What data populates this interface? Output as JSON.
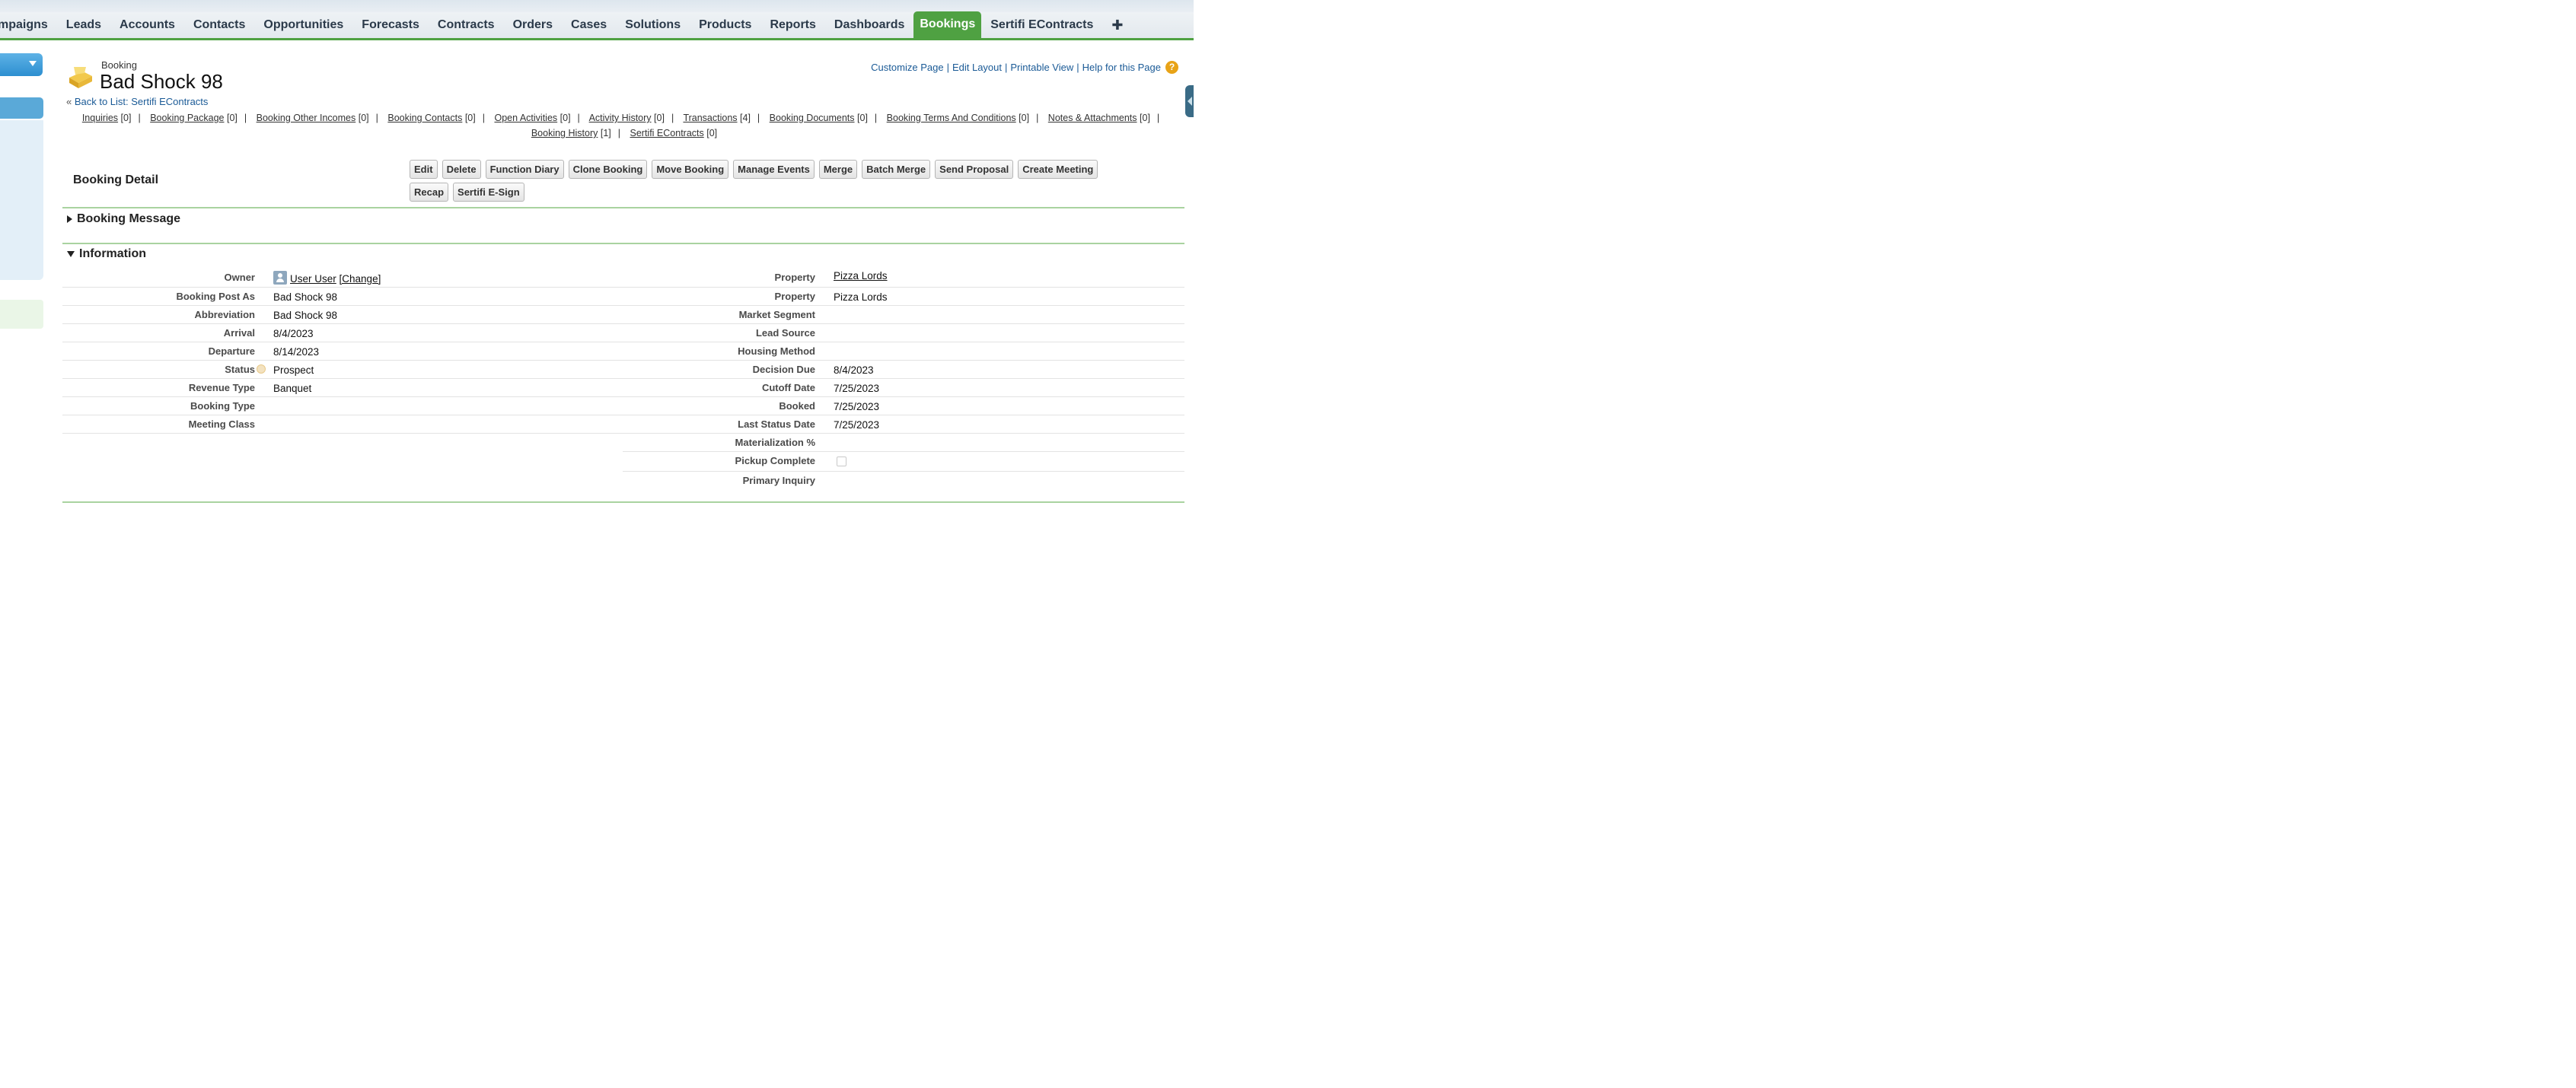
{
  "tabs": [
    {
      "label": "mpaigns"
    },
    {
      "label": "Leads"
    },
    {
      "label": "Accounts"
    },
    {
      "label": "Contacts"
    },
    {
      "label": "Opportunities"
    },
    {
      "label": "Forecasts"
    },
    {
      "label": "Contracts"
    },
    {
      "label": "Orders"
    },
    {
      "label": "Cases"
    },
    {
      "label": "Solutions"
    },
    {
      "label": "Products"
    },
    {
      "label": "Reports"
    },
    {
      "label": "Dashboards"
    },
    {
      "label": "Bookings"
    },
    {
      "label": "Sertifi EContracts"
    },
    {
      "label": "✚"
    }
  ],
  "colors": {
    "accent_green": "#4fa142",
    "link_blue": "#1a5a96"
  },
  "header": {
    "record_type": "Booking",
    "title": "Bad Shock 98",
    "back_prefix": "« ",
    "back_link": "Back to List: Sertifi EContracts",
    "links": {
      "customize": "Customize Page",
      "edit_layout": "Edit Layout",
      "printable": "Printable View",
      "help": "Help for this Page",
      "sep": "|",
      "help_icon_char": "?"
    }
  },
  "related_lists": {
    "row1": [
      {
        "label": "Inquiries",
        "count": "[0]"
      },
      {
        "label": "Booking Package",
        "count": "[0]"
      },
      {
        "label": "Booking Other Incomes",
        "count": "[0]"
      },
      {
        "label": "Booking Contacts",
        "count": "[0]"
      },
      {
        "label": "Open Activities",
        "count": "[0]"
      },
      {
        "label": "Activity History",
        "count": "[0]"
      },
      {
        "label": "Transactions",
        "count": "[4]"
      },
      {
        "label": "Booking Documents",
        "count": "[0]"
      },
      {
        "label": "Booking Terms And Conditions",
        "count": "[0]"
      },
      {
        "label": "Notes & Attachments",
        "count": "[0]"
      }
    ],
    "row2": [
      {
        "label": "Booking History",
        "count": "[1]"
      },
      {
        "label": "Sertifi EContracts",
        "count": "[0]"
      }
    ],
    "sep": "|"
  },
  "detail": {
    "title": "Booking Detail",
    "buttons": [
      "Edit",
      "Delete",
      "Function Diary",
      "Clone Booking",
      "Move Booking",
      "Manage Events",
      "Merge",
      "Batch Merge",
      "Send Proposal",
      "Create Meeting",
      "Recap",
      "Sertifi E-Sign"
    ]
  },
  "sections": {
    "booking_message": "Booking Message",
    "information": "Information"
  },
  "fields_left": [
    {
      "label": "Owner",
      "value": "User User",
      "change": "[Change]"
    },
    {
      "label": "Booking Post As",
      "value": "Bad Shock 98"
    },
    {
      "label": "Abbreviation",
      "value": "Bad Shock 98"
    },
    {
      "label": "Arrival",
      "value": "8/4/2023"
    },
    {
      "label": "Departure",
      "value": "8/14/2023"
    },
    {
      "label": "Status",
      "value": "Prospect"
    },
    {
      "label": "Revenue Type",
      "value": "Banquet"
    },
    {
      "label": "Booking Type",
      "value": ""
    },
    {
      "label": "Meeting Class",
      "value": ""
    }
  ],
  "fields_right": [
    {
      "label": "Property",
      "value": "Pizza Lords"
    },
    {
      "label": "Property",
      "value": "Pizza Lords"
    },
    {
      "label": "Market Segment",
      "value": ""
    },
    {
      "label": "Lead Source",
      "value": ""
    },
    {
      "label": "Housing Method",
      "value": ""
    },
    {
      "label": "Decision Due",
      "value": "8/4/2023"
    },
    {
      "label": "Cutoff Date",
      "value": "7/25/2023"
    },
    {
      "label": "Booked",
      "value": "7/25/2023"
    },
    {
      "label": "Last Status Date",
      "value": "7/25/2023"
    },
    {
      "label": "Materialization %",
      "value": ""
    },
    {
      "label": "Pickup Complete",
      "value": ""
    },
    {
      "label": "Primary Inquiry",
      "value": ""
    }
  ]
}
